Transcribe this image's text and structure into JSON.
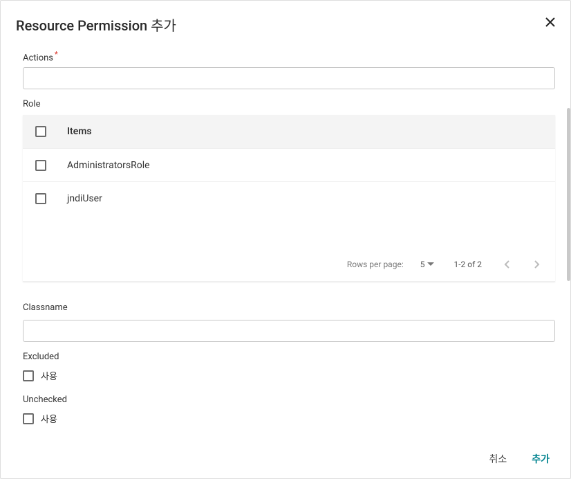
{
  "dialog": {
    "title": "Resource Permission 추가"
  },
  "fields": {
    "actions_label": "Actions",
    "actions_value": "",
    "role_label": "Role",
    "classname_label": "Classname",
    "classname_value": "",
    "excluded_label": "Excluded",
    "unchecked_label": "Unchecked",
    "checkbox_option_label": "사용"
  },
  "table": {
    "header": "Items",
    "rows": [
      {
        "name": "AdministratorsRole"
      },
      {
        "name": "jndiUser"
      }
    ],
    "footer": {
      "rows_per_page_label": "Rows per page:",
      "rows_per_page_value": "5",
      "range": "1-2 of 2"
    }
  },
  "buttons": {
    "cancel": "취소",
    "submit": "추가"
  }
}
